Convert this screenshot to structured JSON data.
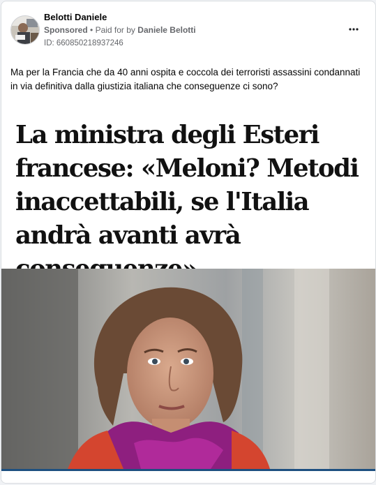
{
  "post": {
    "author": "Belotti Daniele",
    "sponsored": "Sponsored",
    "separator": "•",
    "paid_for_prefix": "Paid for by",
    "paid_for_name": "Daniele Belotti",
    "ad_id": "ID: 660850218937246",
    "text": "Ma per la Francia che da 40 anni ospita e coccola dei terroristi assassini condannati in via definitiva dalla giustizia italiana che conseguenze ci sono?",
    "more_label": "•••"
  },
  "creative": {
    "headline": "La ministra degli Esteri francese: «Meloni? Metodi inaccettabili, se l'Italia andrà avanti avrà conseguenze»"
  },
  "icons": {
    "more": "more-options-icon",
    "avatar": "profile-photo"
  },
  "colors": {
    "text_primary": "#050505",
    "text_secondary": "#65676b",
    "accent_rule": "#1d4f80"
  }
}
